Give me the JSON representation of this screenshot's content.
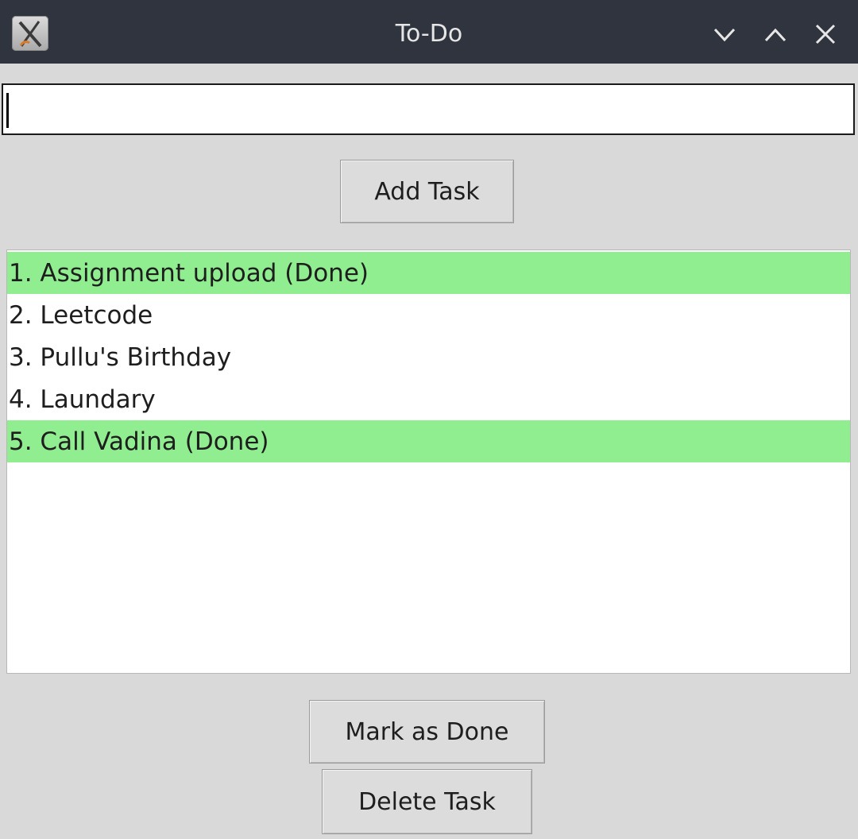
{
  "window": {
    "title": "To-Do",
    "icons": {
      "app": "x-app-icon",
      "minimize": "chevron-down-icon",
      "maximize": "chevron-up-icon",
      "close": "close-icon"
    }
  },
  "task_entry": {
    "value": "",
    "placeholder": ""
  },
  "buttons": {
    "add_task": "Add Task",
    "mark_done": "Mark as Done",
    "delete_task": "Delete Task"
  },
  "tasks": [
    {
      "label": "1. Assignment upload (Done)",
      "done": true
    },
    {
      "label": "2. Leetcode",
      "done": false
    },
    {
      "label": "3. Pullu's Birthday",
      "done": false
    },
    {
      "label": "4. Laundary",
      "done": false
    },
    {
      "label": "5. Call Vadina (Done)",
      "done": true
    }
  ],
  "colors": {
    "titlebar": "#2f343f",
    "window_bg": "#d9d9d9",
    "done_highlight": "#90ee90",
    "list_bg": "#ffffff"
  }
}
